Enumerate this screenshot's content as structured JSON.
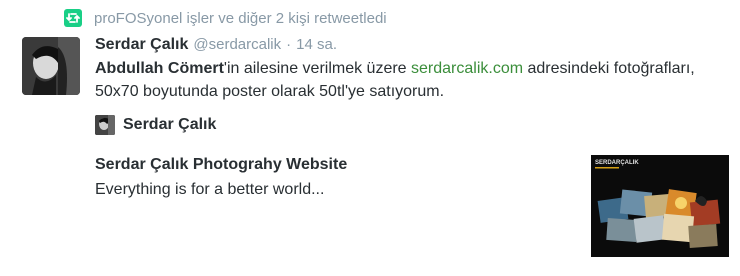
{
  "retweet": {
    "text": "proFOSyonel işler ve diğer 2 kişi retweetledi",
    "icon": "retweet-icon",
    "color": "#19cf86"
  },
  "tweet": {
    "author_name": "Serdar Çalık",
    "handle": "@serdarcalik",
    "separator": "·",
    "time": "14 sa.",
    "mention": "Abdullah Cömert",
    "text_part1": "'in ailesine verilmek üzere ",
    "link": "serdarcalik.com",
    "text_part2": " adresindeki fotoğrafları, 50x70 boyutunda poster olarak 50tl'ye satıyorum.",
    "link_color": "#3b8e3b"
  },
  "card": {
    "author_name": "Serdar Çalık",
    "title": "Serdar Çalık Photograhy Website",
    "description": "Everything is for a better world...",
    "thumb_logo": "SERDARÇALIK"
  }
}
